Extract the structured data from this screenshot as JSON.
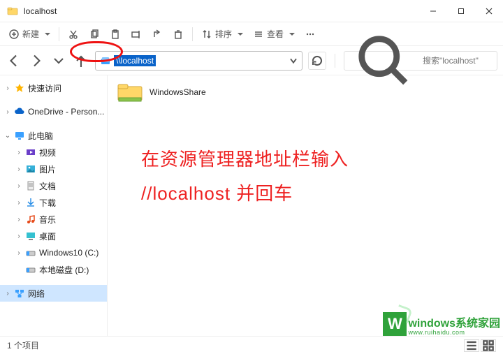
{
  "window": {
    "title": "localhost"
  },
  "toolbar": {
    "new_label": "新建",
    "sort_label": "排序",
    "view_label": "查看"
  },
  "nav": {
    "address_text": "\\\\localhost",
    "search_placeholder": "搜索\"localhost\""
  },
  "sidebar": {
    "quick_access": "快速访问",
    "onedrive": "OneDrive - Person...",
    "this_pc": "此电脑",
    "videos": "视频",
    "pictures": "图片",
    "documents": "文档",
    "downloads": "下载",
    "music": "音乐",
    "desktop": "桌面",
    "drive_c": "Windows10 (C:)",
    "drive_d": "本地磁盘 (D:)",
    "network": "网络"
  },
  "content": {
    "items": [
      {
        "name": "WindowsShare"
      }
    ]
  },
  "overlay": {
    "line1": "在资源管理器地址栏输入",
    "line2": "//localhost   并回车"
  },
  "statusbar": {
    "item_count": "1 个项目"
  },
  "watermark": {
    "line1": "windows系统家园",
    "line2": "www.ruihaidu.com",
    "badge": "W"
  }
}
